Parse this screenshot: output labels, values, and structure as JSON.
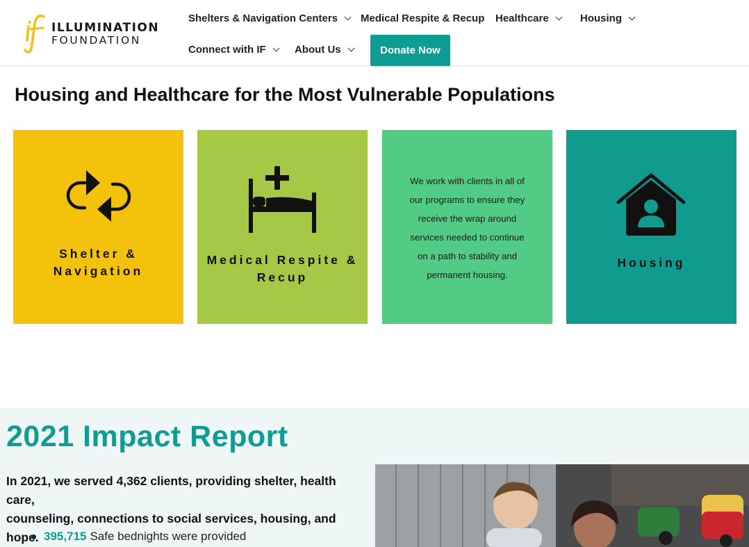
{
  "brand": {
    "logo_text_1": "ILLUMINATION",
    "logo_text_2": "FOUNDATION",
    "logo_mark": "if",
    "accent_color": "#0f9c94",
    "logo_color": "#f2c00f"
  },
  "nav": {
    "items": [
      {
        "label": "Shelters & Navigation Centers",
        "has_dropdown": true
      },
      {
        "label": "Medical Respite & Recup",
        "has_dropdown": false
      },
      {
        "label": "Healthcare",
        "has_dropdown": true
      },
      {
        "label": "Housing",
        "has_dropdown": true
      },
      {
        "label": "Connect with IF",
        "has_dropdown": true
      },
      {
        "label": "About Us",
        "has_dropdown": true
      }
    ],
    "donate_label": "Donate Now"
  },
  "section": {
    "title": "Housing and Healthcare for the Most Vulnerable Populations"
  },
  "cards": [
    {
      "label_line1": "Shelter &",
      "label_line2": "Navigation",
      "color": "#f4c20d",
      "icon": "cycle-arrows-icon"
    },
    {
      "label_line1": "Medical Respite &",
      "label_line2": "Recup",
      "color": "#a5c946",
      "icon": "hospital-bed-icon"
    },
    {
      "text_lines": [
        "We work with clients in all of",
        "our programs to ensure they",
        "receive the wrap around",
        "services needed to continue",
        "on a path to stability and",
        "permanent housing."
      ],
      "color": "#52cb84"
    },
    {
      "label": "Housing",
      "color": "#0f9c8f",
      "icon": "house-person-icon"
    }
  ],
  "impact": {
    "title": "2021 Impact Report",
    "lead_line1": "In 2021, we served 4,362 clients, providing shelter, health care,",
    "lead_line2": "counseling, connections to social services, housing, and hope.",
    "bullets": [
      {
        "number": "395,715",
        "text": "Safe bednights were provided"
      }
    ],
    "photo_alt": "children-playing-photo"
  }
}
